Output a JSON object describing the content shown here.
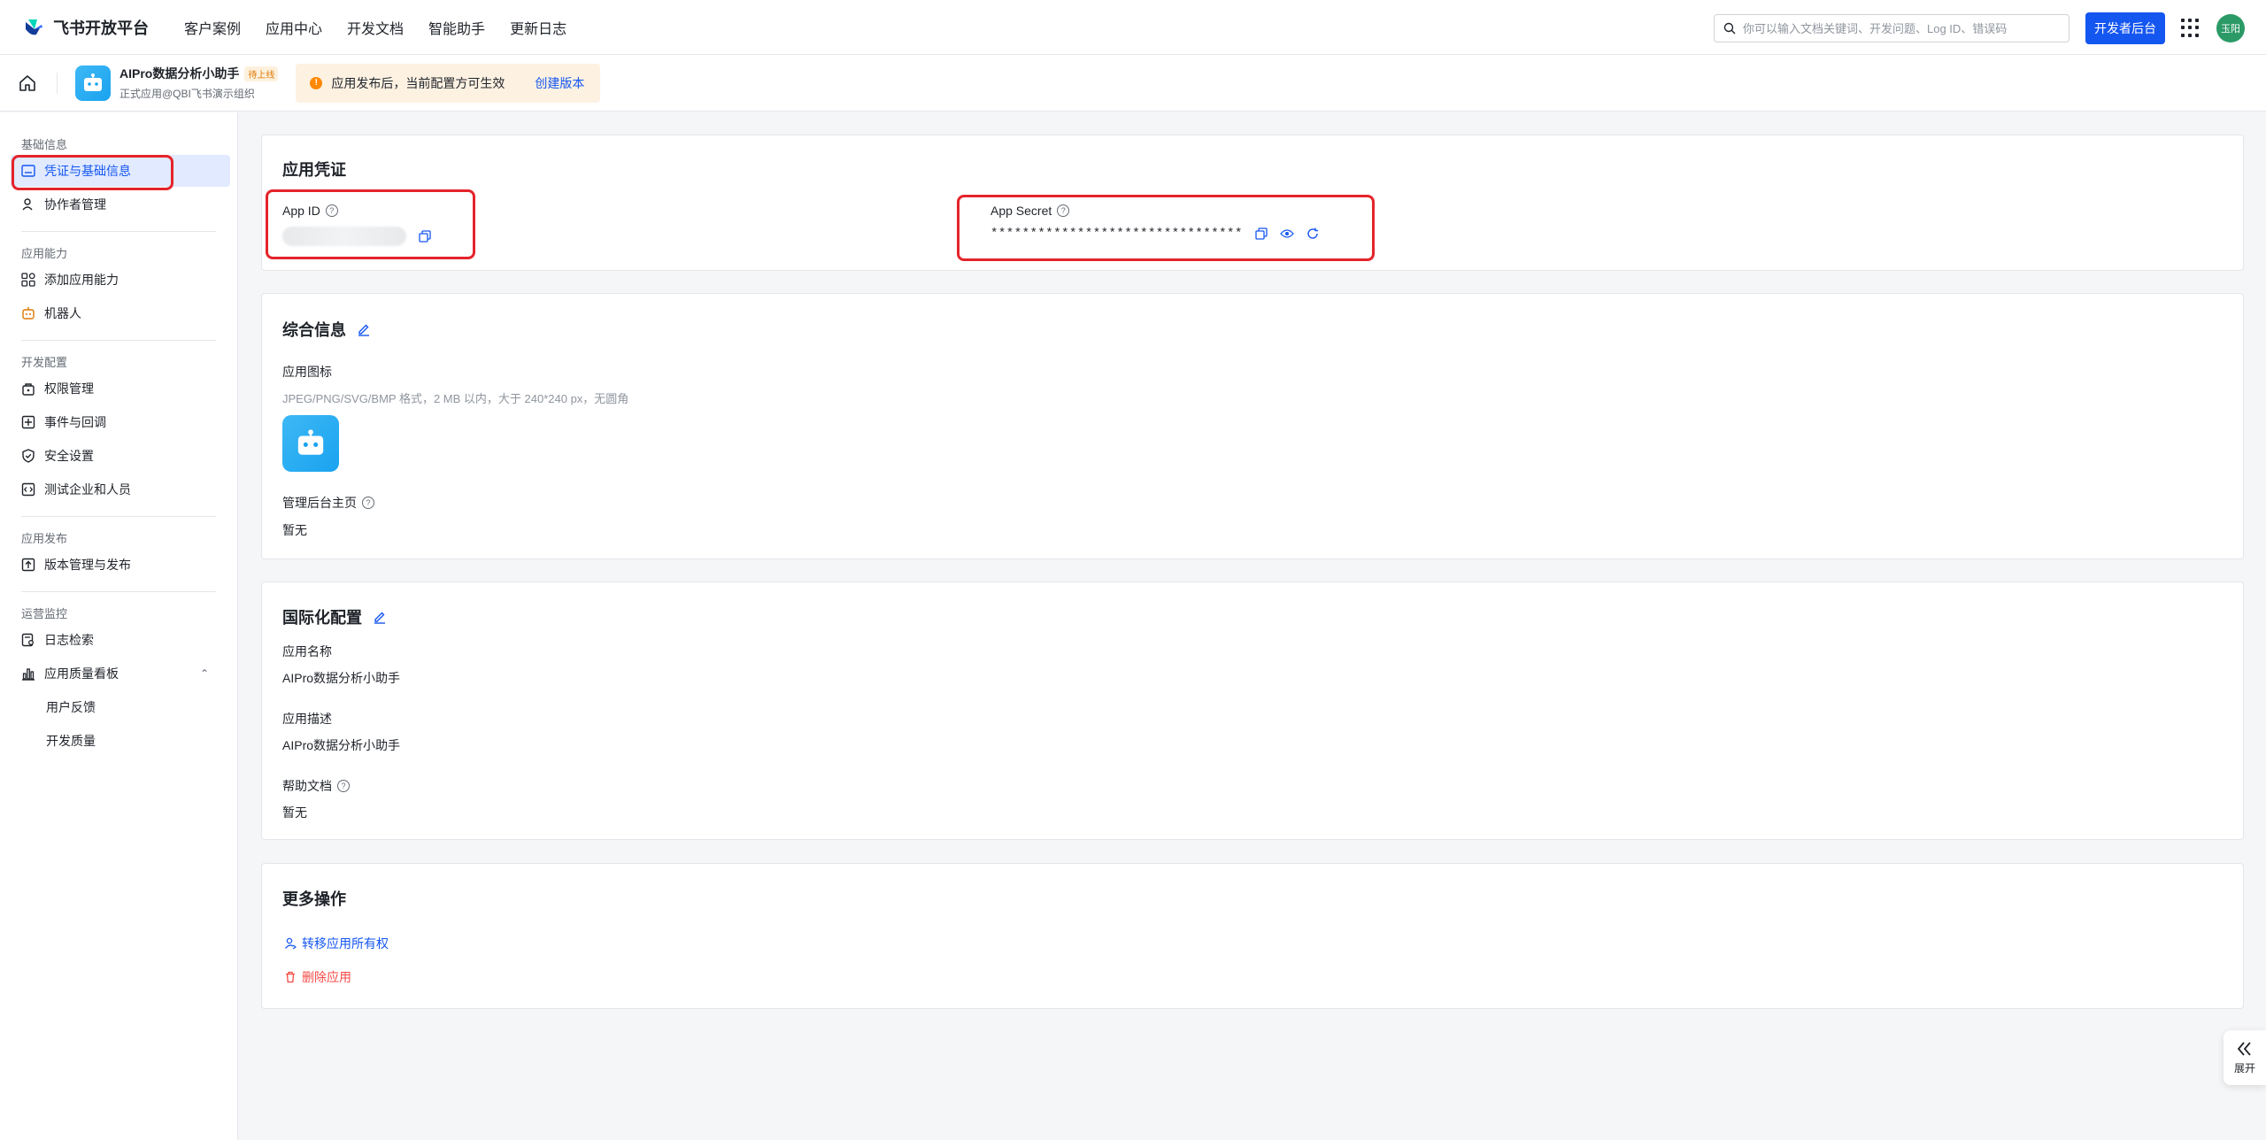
{
  "topnav": {
    "brand": "飞书开放平台",
    "links": [
      "客户案例",
      "应用中心",
      "开发文档",
      "智能助手",
      "更新日志"
    ],
    "search_placeholder": "你可以输入文档关键词、开发问题、Log ID、错误码",
    "dev_console": "开发者后台",
    "avatar_text": "玉阳"
  },
  "subheader": {
    "app_name": "AIPro数据分析小助手",
    "status_tag": "待上线",
    "app_sub": "正式应用@QBI飞书演示组织",
    "notice": "应用发布后，当前配置方可生效",
    "notice_action": "创建版本"
  },
  "sidebar": {
    "groups": {
      "basic": "基础信息",
      "ability": "应用能力",
      "dev": "开发配置",
      "release": "应用发布",
      "ops": "运营监控"
    },
    "items": {
      "credentials": "凭证与基础信息",
      "collaborators": "协作者管理",
      "add_ability": "添加应用能力",
      "bot": "机器人",
      "permissions": "权限管理",
      "events": "事件与回调",
      "security": "安全设置",
      "test_org": "测试企业和人员",
      "versions": "版本管理与发布",
      "logs": "日志检索",
      "quality": "应用质量看板",
      "feedback": "用户反馈",
      "dev_quality": "开发质量"
    }
  },
  "credentials": {
    "title": "应用凭证",
    "app_id_label": "App ID",
    "app_secret_label": "App Secret",
    "app_secret_value": "********************************"
  },
  "general": {
    "title": "综合信息",
    "icon_label": "应用图标",
    "icon_hint": "JPEG/PNG/SVG/BMP 格式，2 MB 以内，大于 240*240 px，无圆角",
    "admin_label": "管理后台主页",
    "admin_value": "暂无"
  },
  "i18n": {
    "title": "国际化配置",
    "name_label": "应用名称",
    "name_value": "AIPro数据分析小助手",
    "desc_label": "应用描述",
    "desc_value": "AIPro数据分析小助手",
    "help_label": "帮助文档",
    "help_value": "暂无"
  },
  "more": {
    "title": "更多操作",
    "transfer": "转移应用所有权",
    "delete": "删除应用"
  },
  "expand_label": "展开",
  "colors": {
    "primary": "#1456f0",
    "danger": "#f54a45",
    "highlight": "#e5242b"
  }
}
